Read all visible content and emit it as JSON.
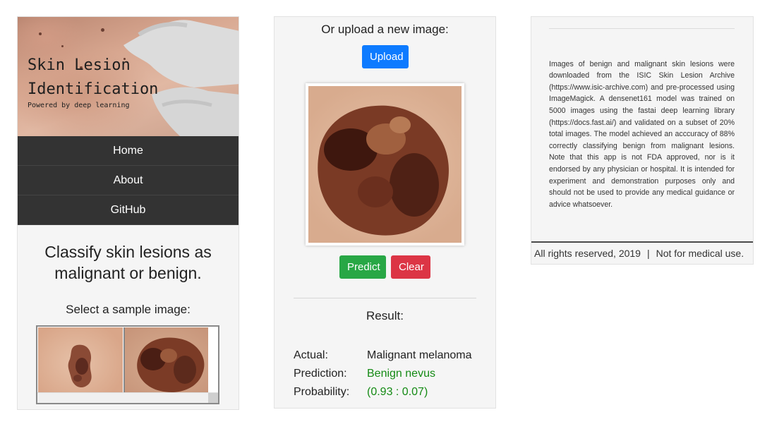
{
  "header": {
    "title_line1": "Skin Lesion",
    "title_line2": "Identification",
    "subtitle": "Powered by deep learning"
  },
  "nav": {
    "items": [
      {
        "label": "Home"
      },
      {
        "label": "About"
      },
      {
        "label": "GitHub"
      }
    ],
    "background": "#333333"
  },
  "main": {
    "tagline": "Classify skin lesions as malignant or benign.",
    "sample_label": "Select a sample image:"
  },
  "upload": {
    "label": "Or upload a new image:",
    "button": "Upload"
  },
  "actions": {
    "predict": "Predict",
    "clear": "Clear"
  },
  "result": {
    "heading": "Result:",
    "actual_label": "Actual:",
    "actual_value": "Malignant melanoma",
    "prediction_label": "Prediction:",
    "prediction_value": "Benign nevus",
    "probability_label": "Probability:",
    "probability_value": "(0.93 : 0.07)"
  },
  "about": {
    "text": "Images of benign and malignant skin lesions were downloaded from the ISIC Skin Lesion Archive (https://www.isic-archive.com) and pre-processed using ImageMagick. A densenet161 model was trained on 5000 images using the fastai deep learning library (https://docs.fast.ai/) and validated on a subset of 20% total images. The model achieved an acccuracy of 88% correctly classifying benign from malignant lesions. Note that this app is not FDA approved, nor is it endorsed by any physician or hospital. It is intended for experiment and demonstration purposes only and should not be used to provide any medical guidance or advice whatsoever."
  },
  "footer": {
    "rights": "All rights reserved, 2019",
    "separator": "|",
    "disclaimer": "Not for medical use."
  },
  "colors": {
    "upload": "#0d7bff",
    "predict": "#28a745",
    "clear": "#dc3545",
    "result_green": "#148a14"
  }
}
